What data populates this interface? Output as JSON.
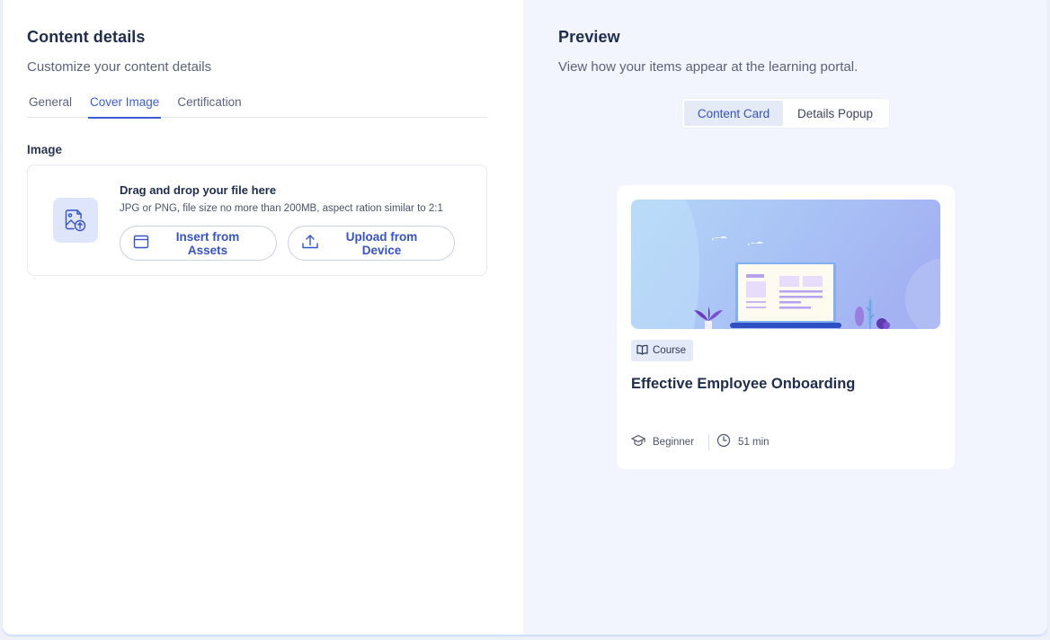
{
  "content_details": {
    "title": "Content details",
    "subtitle": "Customize your content details",
    "tabs": [
      {
        "label": "General",
        "active": false
      },
      {
        "label": "Cover Image",
        "active": true
      },
      {
        "label": "Certification",
        "active": false
      }
    ],
    "image_section": {
      "label": "Image",
      "dropzone": {
        "title": "Drag and drop your file here",
        "hint": "JPG or PNG, file size no more than 200MB, aspect ration similar to 2:1",
        "icon": "image-upload-icon",
        "insert_label": "Insert from Assets",
        "upload_label": "Upload from Device"
      }
    }
  },
  "preview": {
    "title": "Preview",
    "subtitle": "View how your items appear at the learning portal.",
    "segments": [
      {
        "label": "Content Card",
        "active": true
      },
      {
        "label": "Details Popup",
        "active": false
      }
    ],
    "card": {
      "badge": "Course",
      "title": "Effective Employee Onboarding",
      "level": "Beginner",
      "duration": "51 min"
    }
  },
  "colors": {
    "accent": "#3b5bdb",
    "right_bg": "#f2f5fd",
    "icon_tile": "#dfe6fb"
  }
}
